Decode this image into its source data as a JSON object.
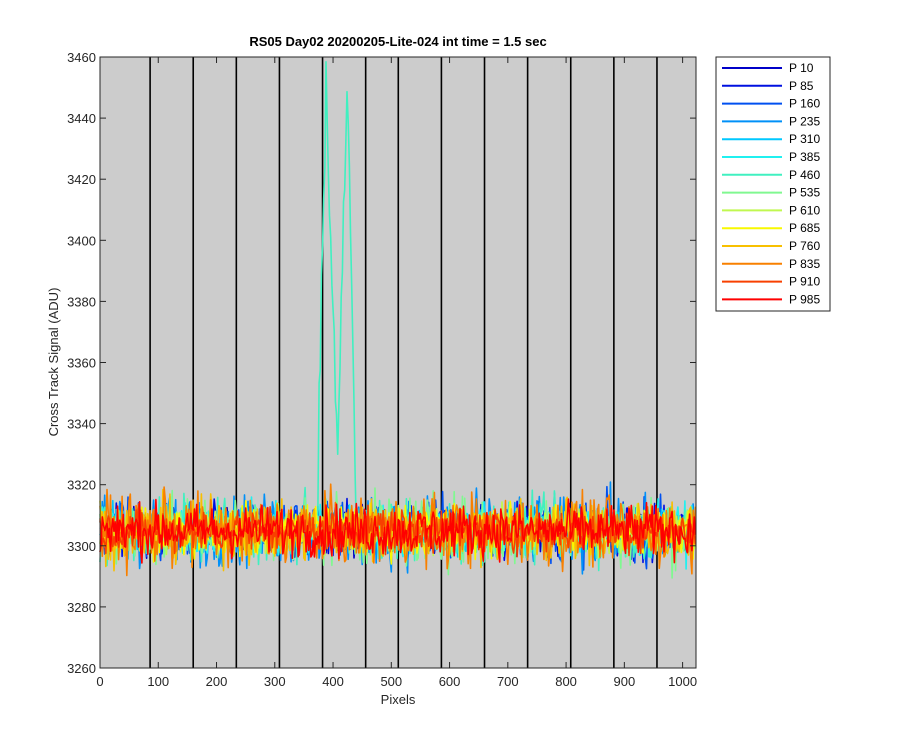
{
  "chart_data": {
    "type": "line",
    "title": "RS05 Day02 20200205-Lite-024 int time = 1.5 sec",
    "xlabel": "Pixels",
    "ylabel": "Cross Track Signal (ADU)",
    "xlim": [
      0,
      1023
    ],
    "ylim": [
      3260,
      3460
    ],
    "x_ticks": [
      0,
      100,
      200,
      300,
      400,
      500,
      600,
      700,
      800,
      900,
      1000
    ],
    "y_ticks": [
      3260,
      3280,
      3300,
      3320,
      3340,
      3360,
      3380,
      3400,
      3420,
      3440,
      3460
    ],
    "vertical_lines_x": [
      86,
      160,
      234,
      308,
      382,
      456,
      512,
      586,
      660,
      734,
      808,
      882,
      956
    ],
    "background": "#cccccc",
    "legend_position": "outside-top-right",
    "baseline": 3305,
    "noise_amplitude": 15,
    "series": [
      {
        "name": "P 10",
        "color": "#0000c8"
      },
      {
        "name": "P 85",
        "color": "#0010e0"
      },
      {
        "name": "P 160",
        "color": "#0050f0"
      },
      {
        "name": "P 235",
        "color": "#0090f8"
      },
      {
        "name": "P 310",
        "color": "#00c8ff"
      },
      {
        "name": "P 385",
        "color": "#20f0f0"
      },
      {
        "name": "P 460",
        "color": "#40f0c0",
        "spike": {
          "x_start": 373,
          "x_end": 440,
          "peaks": [
            {
              "x": 388,
              "y": 3446
            },
            {
              "x": 425,
              "y": 3457
            }
          ],
          "trough": {
            "x": 408,
            "y": 3330
          }
        }
      },
      {
        "name": "P 535",
        "color": "#80f890"
      },
      {
        "name": "P 610",
        "color": "#c0f850"
      },
      {
        "name": "P 685",
        "color": "#f8f800"
      },
      {
        "name": "P 760",
        "color": "#f8c000"
      },
      {
        "name": "P 835",
        "color": "#f88000"
      },
      {
        "name": "P 910",
        "color": "#f84000"
      },
      {
        "name": "P 985",
        "color": "#ff0000"
      }
    ]
  }
}
